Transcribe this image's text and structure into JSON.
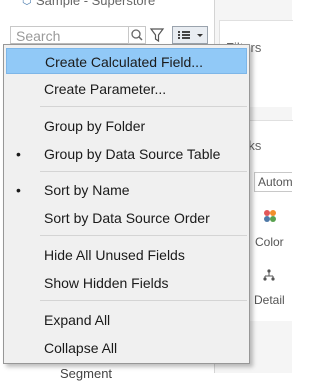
{
  "data_source": {
    "icon": "datasource-icon",
    "name": "Sample - Superstore"
  },
  "search": {
    "placeholder": "Search"
  },
  "toolbar": {
    "search_icon": "magnifier-icon",
    "filter_icon": "funnel-icon",
    "view_icon": "list-view-icon"
  },
  "panels": {
    "filters_label": "Filters",
    "marks_label": "Marks",
    "mark_type": "Automatic",
    "color_label": "Color",
    "detail_label": "Detail"
  },
  "below_field": "Segment",
  "menu": {
    "items": [
      {
        "label": "Create Calculated Field...",
        "checked": false,
        "highlighted": true
      },
      {
        "label": "Create Parameter...",
        "checked": false
      },
      {
        "label": "Group by Folder",
        "checked": false
      },
      {
        "label": "Group by Data Source Table",
        "checked": true
      },
      {
        "label": "Sort by Name",
        "checked": true
      },
      {
        "label": "Sort by Data Source Order",
        "checked": false
      },
      {
        "label": "Hide All Unused Fields",
        "checked": false
      },
      {
        "label": "Show Hidden Fields",
        "checked": false
      },
      {
        "label": "Expand All",
        "checked": false
      },
      {
        "label": "Collapse All",
        "checked": false
      }
    ],
    "bullet": "•"
  },
  "colors": {
    "highlight": "#91c9f7",
    "menu_bg": "#f0f0f0",
    "accent": "#4f7fb0"
  }
}
